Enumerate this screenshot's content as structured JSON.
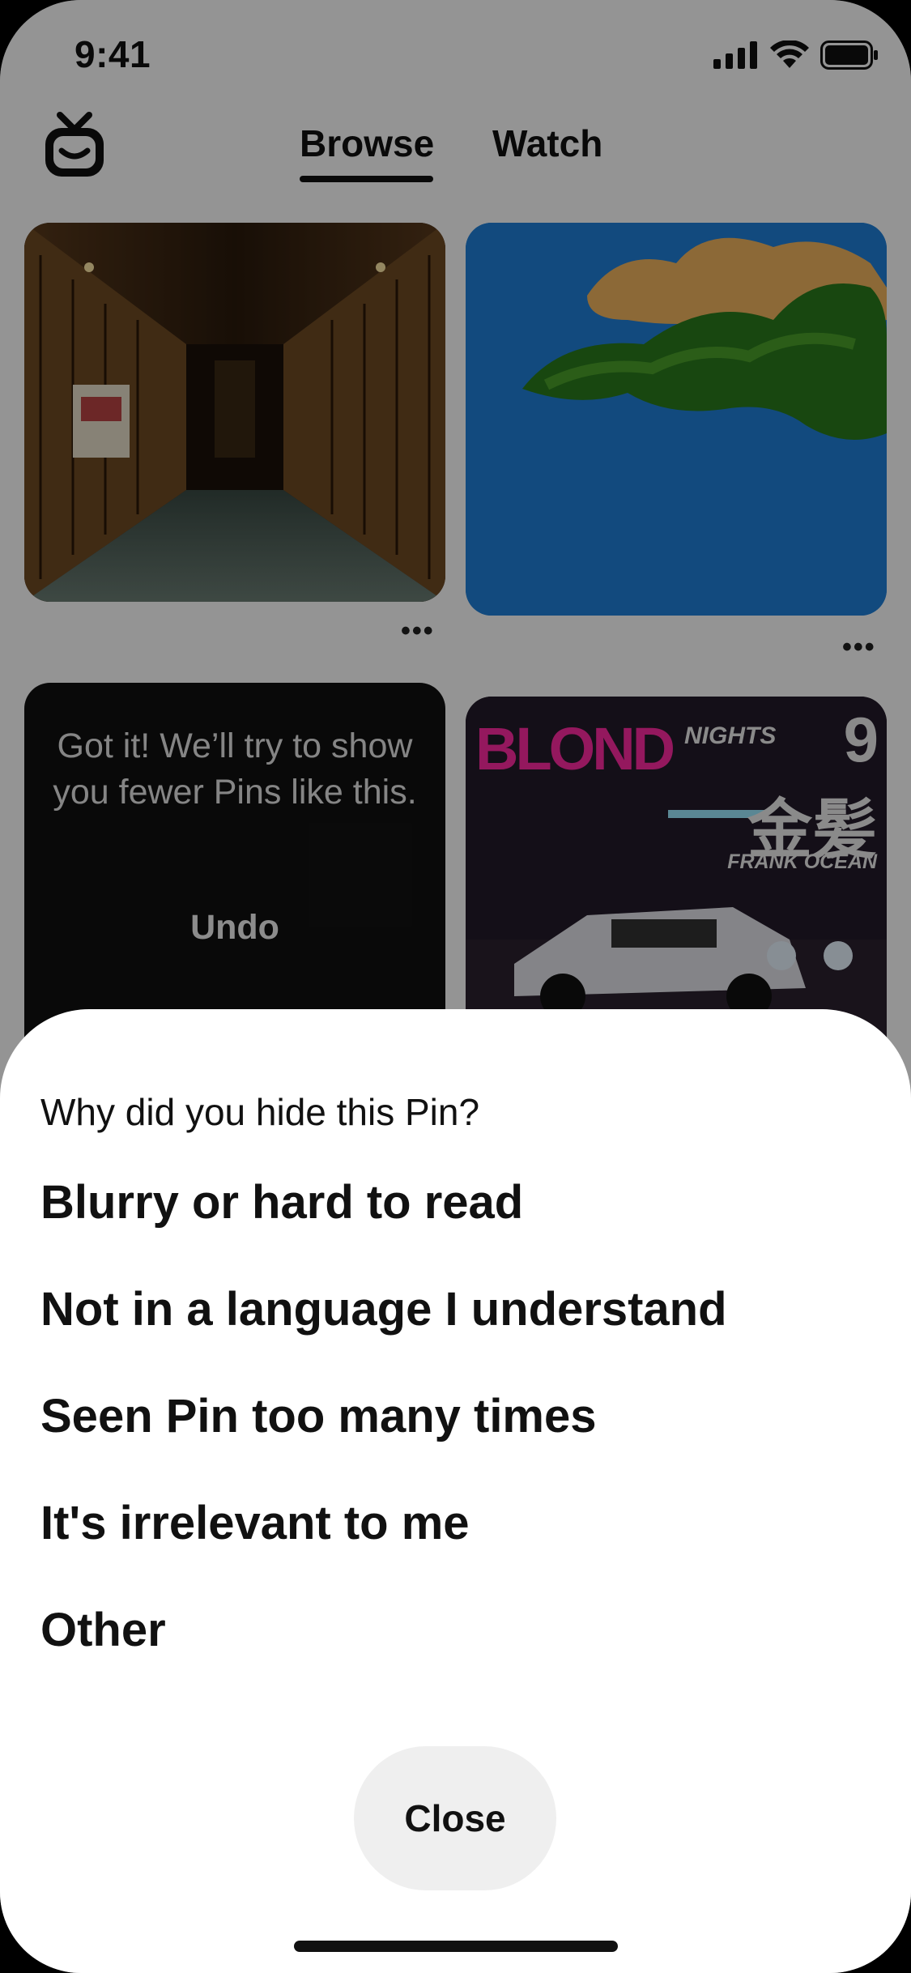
{
  "status_bar": {
    "time": "9:41",
    "icons": [
      "cellular-signal-icon",
      "wifi-icon",
      "battery-icon"
    ]
  },
  "header": {
    "logo_icon": "tv-smile-icon",
    "tabs": [
      {
        "label": "Browse",
        "selected": true
      },
      {
        "label": "Watch",
        "selected": false
      }
    ]
  },
  "feed": {
    "pins": [
      {
        "image": "ornate library hall",
        "more_label": "•••"
      },
      {
        "image": "sky with clouds and tree",
        "more_label": "•••"
      },
      {
        "hidden_message": "Got it! We’ll try to show you fewer Pins like this.",
        "undo_label": "Undo"
      },
      {
        "poster": {
          "title": "BLOND",
          "subtitle": "NIGHTS",
          "number": "9",
          "kanji": "金髪",
          "artist": "FRANK OCEAN"
        }
      }
    ]
  },
  "sheet": {
    "title": "Why did you hide this Pin?",
    "options": [
      "Blurry or hard to read",
      "Not in a language I understand",
      "Seen Pin too many times",
      "It's irrelevant to me",
      "Other"
    ],
    "close_label": "Close"
  },
  "colors": {
    "overlay": "#000000",
    "sheet_bg": "#ffffff",
    "close_bg": "#efefef",
    "text": "#111111",
    "poster_accent": "#ff2aa3"
  }
}
